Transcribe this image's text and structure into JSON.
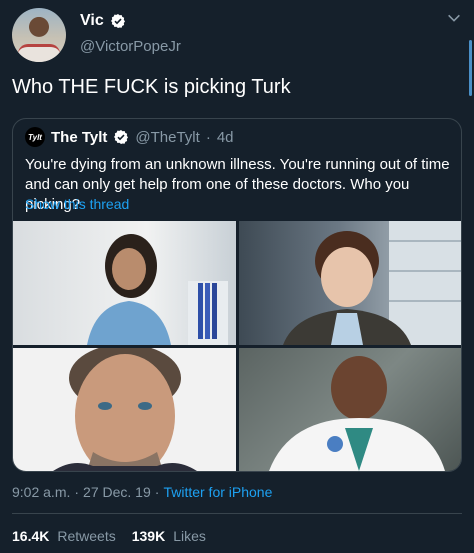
{
  "author": {
    "display_name": "Vic",
    "handle": "@VictorPopeJr"
  },
  "tweet": {
    "text": "Who THE FUCK is picking Turk"
  },
  "quoted": {
    "avatar_text": "Tylt",
    "display_name": "The Tylt",
    "handle": "@TheTylt",
    "separator": "·",
    "age": "4d",
    "text": "You're dying from an unknown illness. You're running out of time and can only get help from one of these doctors. Who you picking?",
    "show_thread": "Show this thread",
    "images": [
      "doctor-photo-1",
      "doctor-photo-2",
      "doctor-photo-3",
      "doctor-photo-4"
    ]
  },
  "meta": {
    "time": "9:02 a.m.",
    "separator": "·",
    "date": "27 Dec. 19",
    "separator2": "·",
    "source": "Twitter for iPhone"
  },
  "stats": {
    "retweets_count": "16.4K",
    "retweets_label": "Retweets",
    "likes_count": "139K",
    "likes_label": "Likes"
  },
  "colors": {
    "background": "#15202b",
    "accent": "#1da1f2",
    "muted": "#8899a6",
    "border": "#38444d"
  },
  "icons": [
    "verified-badge-icon",
    "chevron-down-icon"
  ]
}
